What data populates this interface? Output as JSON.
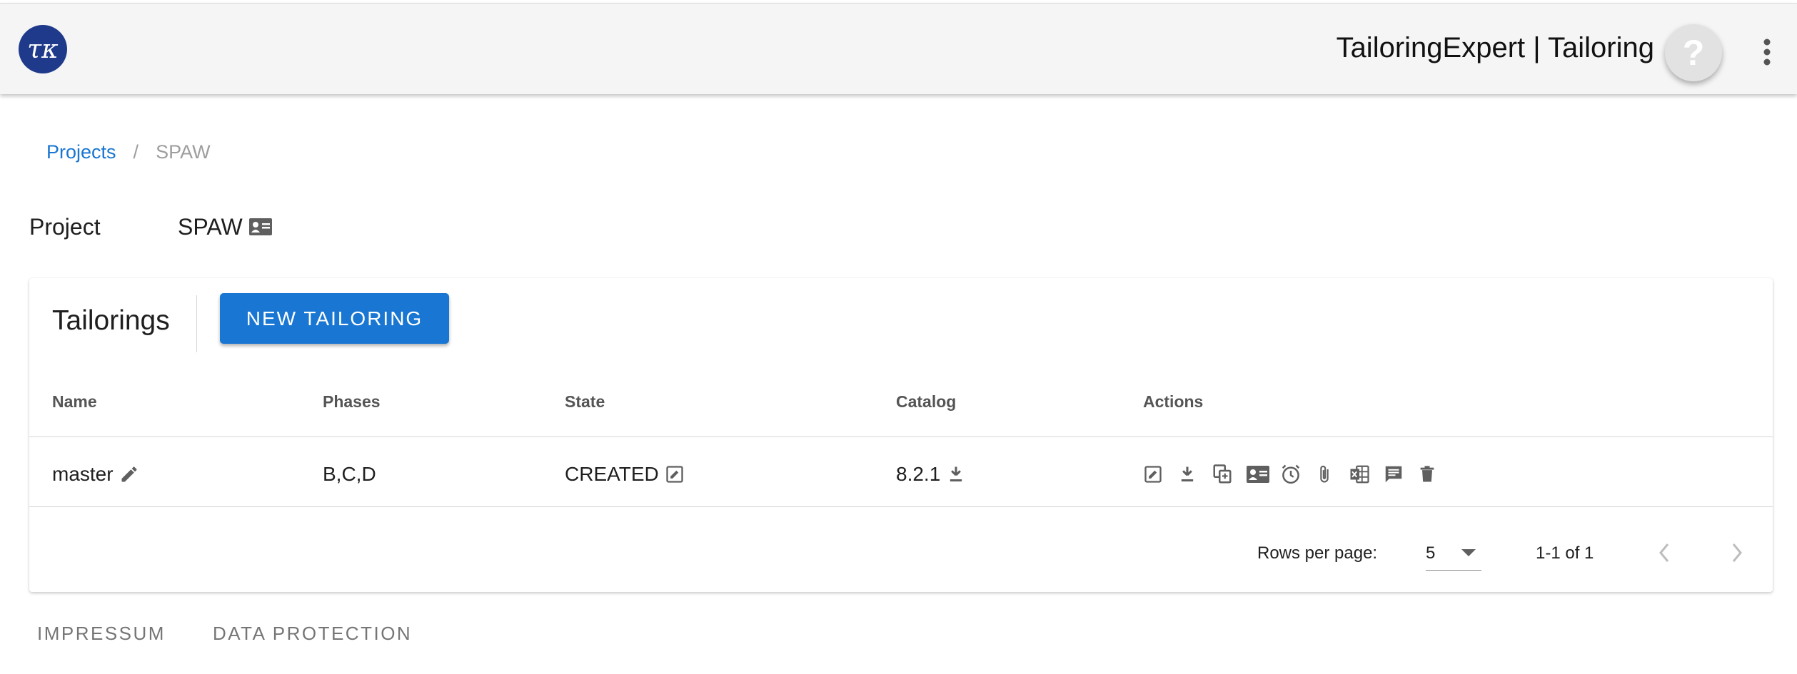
{
  "header": {
    "app_title": "TailoringExpert | Tailoring",
    "help_symbol": "?"
  },
  "breadcrumb": {
    "items": [
      {
        "label": "Projects"
      },
      {
        "label": "SPAW"
      }
    ],
    "separator": "/"
  },
  "project": {
    "label": "Project",
    "name": "SPAW"
  },
  "tailorings": {
    "title": "Tailorings",
    "new_button": "NEW TAILORING",
    "columns": [
      "Name",
      "Phases",
      "State",
      "Catalog",
      "Actions"
    ],
    "rows": [
      {
        "name": "master",
        "phases": "B,C,D",
        "state": "CREATED",
        "catalog": "8.2.1"
      }
    ],
    "actions_icons": [
      "edit-box-icon",
      "download-icon",
      "copy-compare-icon",
      "id-card-icon",
      "clock-check-icon",
      "attachment-icon",
      "excel-icon",
      "comment-icon",
      "delete-icon"
    ],
    "pagination": {
      "rows_per_page_label": "Rows per page:",
      "rows_per_page_value": "5",
      "range": "1-1 of 1"
    }
  },
  "footer": {
    "impressum": "IMPRESSUM",
    "data_protection": "DATA PROTECTION"
  },
  "colors": {
    "primary": "#1976d2",
    "logo_bg": "#1f3a8a",
    "icon_gray": "#5f5f5f"
  }
}
